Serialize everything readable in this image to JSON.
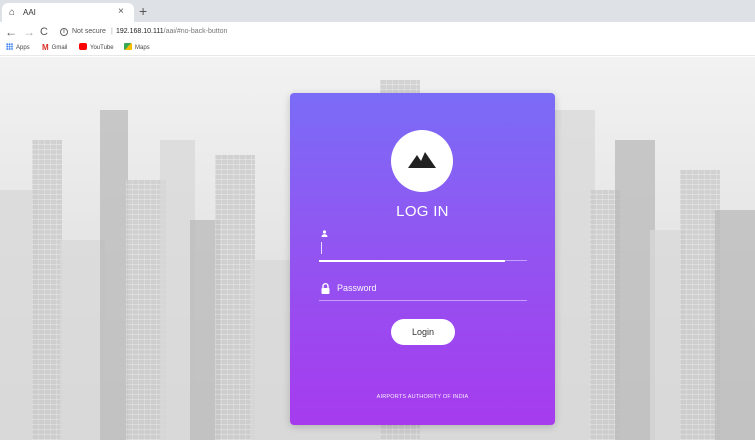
{
  "browser": {
    "tab_title": "AAI",
    "tab_close": "×",
    "new_tab": "+",
    "nav": {
      "back": "←",
      "forward": "→",
      "reload": "C"
    },
    "security_label": "Not secure",
    "separator": "|",
    "url_host": "192.168.10.111",
    "url_path": "/aai/#no-back-button",
    "bookmarks": [
      {
        "label": "Apps",
        "icon": "apps-grid-icon"
      },
      {
        "label": "Gmail",
        "icon": "gmail-icon",
        "color": "#d93025"
      },
      {
        "label": "YouTube",
        "icon": "youtube-icon",
        "color": "#ff0000"
      },
      {
        "label": "Maps",
        "icon": "maps-icon",
        "color": "#34a853"
      }
    ]
  },
  "login": {
    "logo_icon": "mountain-icon",
    "title": "LOG IN",
    "username_value": "",
    "username_icon": "user-icon",
    "password_icon": "lock-icon",
    "password_placeholder": "Password",
    "button_label": "Login",
    "footer": "AIRPORTS AUTHORITY OF INDIA",
    "gradient_top": "#7a6cf7",
    "gradient_bottom": "#a63bee"
  }
}
